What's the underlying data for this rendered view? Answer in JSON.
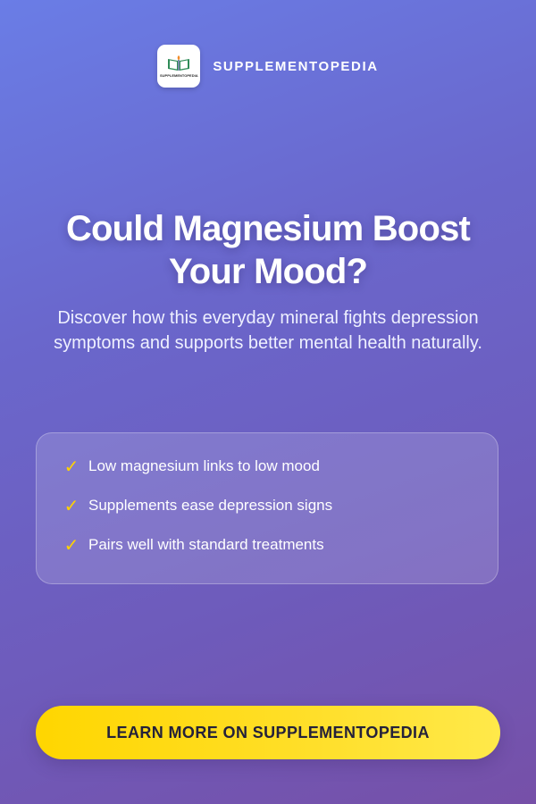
{
  "brand": {
    "name": "SUPPLEMENTOPEDIA",
    "logo_text": "SUPPLEMENTOPEDIA",
    "logo_icon": "book-icon"
  },
  "headline": "Could Magnesium Boost Your Mood?",
  "subheadline": "Discover how this everyday mineral fights depression symptoms and supports better mental health naturally.",
  "benefits": [
    "Low magnesium links to low mood",
    "Supplements ease depression signs",
    "Pairs well with standard treatments"
  ],
  "check_icon": "checkmark-icon",
  "cta": {
    "label": "LEARN MORE ON SUPPLEMENTOPEDIA"
  },
  "colors": {
    "background_start": "#6a7de6",
    "background_end": "#7650a8",
    "accent_yellow": "#ffd600",
    "cta_text": "#24213a"
  }
}
